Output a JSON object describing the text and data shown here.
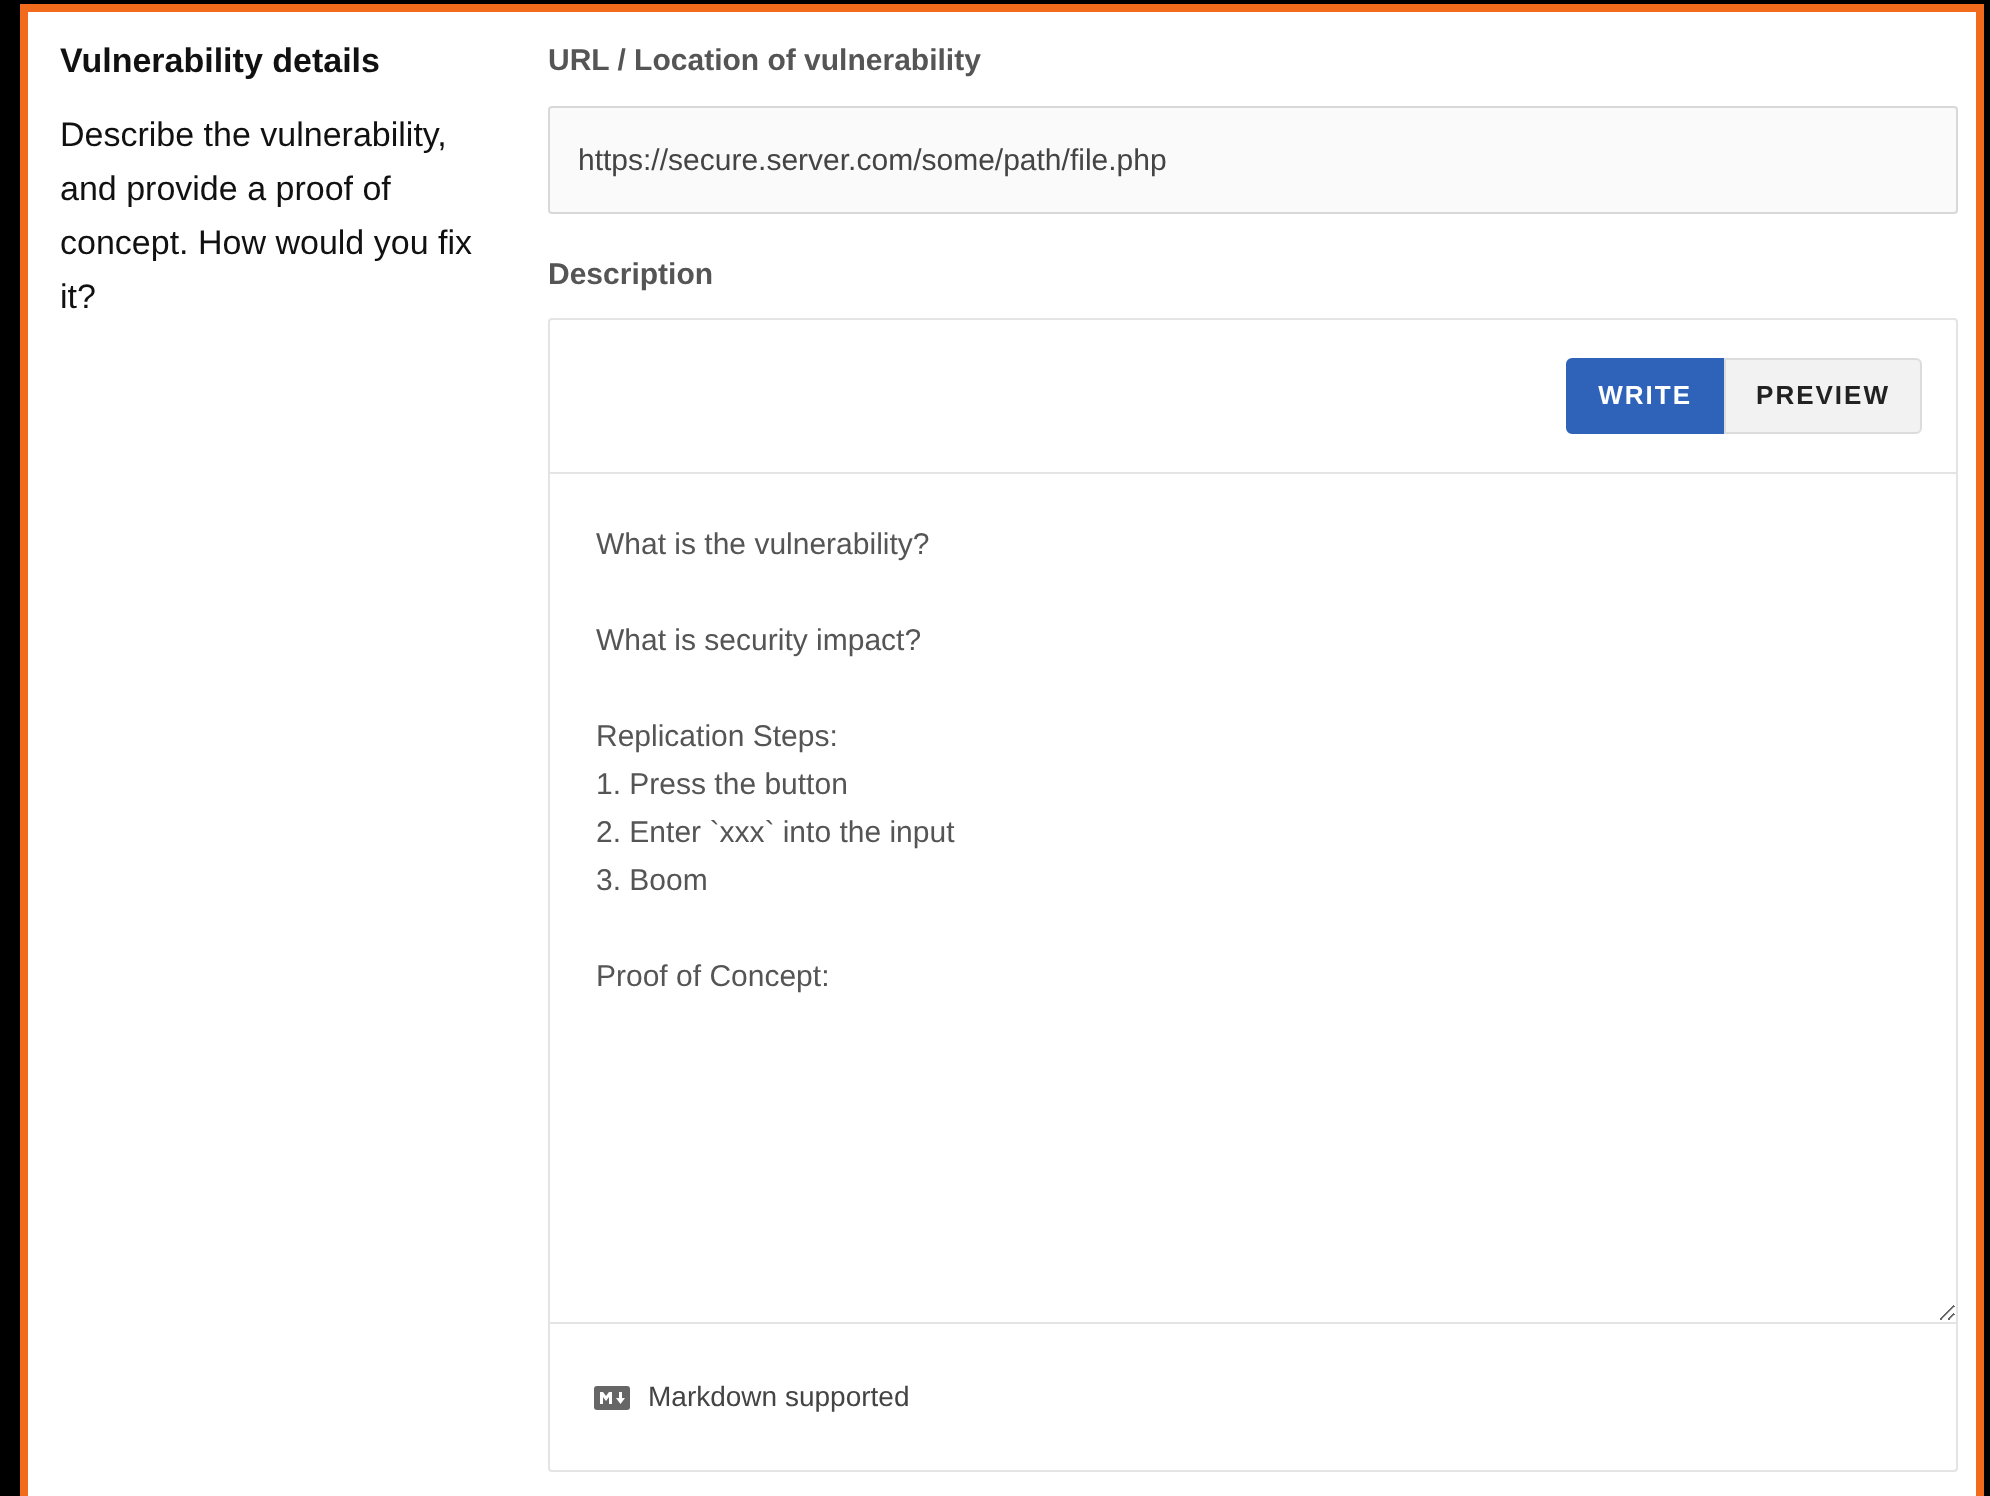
{
  "section": {
    "title": "Vulnerability details",
    "description": "Describe the vulnerability, and provide a proof of concept. How would you fix it?"
  },
  "url_field": {
    "label": "URL / Location of vulnerability",
    "value": "https://secure.server.com/some/path/file.php"
  },
  "description": {
    "label": "Description",
    "tabs": [
      {
        "label": "WRITE",
        "selected": true
      },
      {
        "label": "PREVIEW",
        "selected": false
      }
    ],
    "value": "What is the vulnerability?\n\nWhat is security impact?\n\nReplication Steps:\n1. Press the button\n2. Enter `xxx` into the input\n3. Boom\n\nProof of Concept:",
    "footer": "Markdown supported"
  }
}
